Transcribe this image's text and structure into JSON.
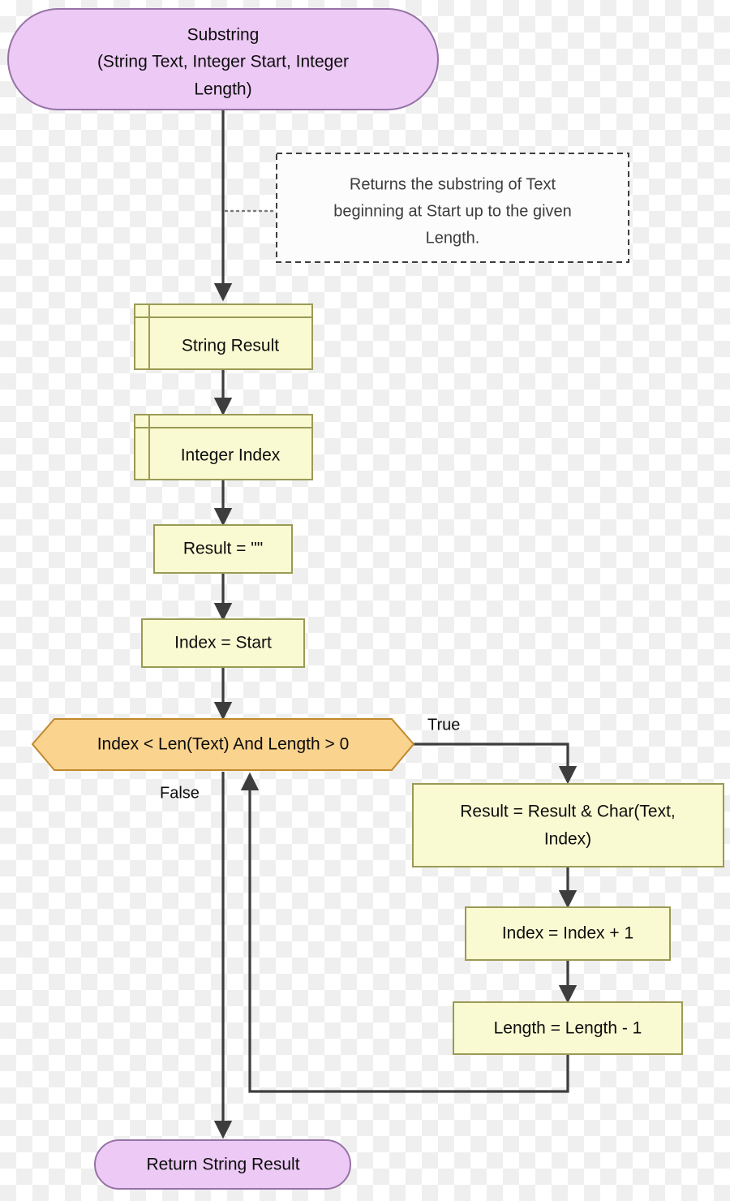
{
  "diagram": {
    "title": "Substring function flowchart",
    "colors": {
      "terminal_fill": "#edc9f5",
      "terminal_stroke": "#9673a6",
      "process_fill": "#fafad2",
      "process_stroke": "#9a9a55",
      "decision_fill": "#fad38e",
      "decision_stroke": "#c08a2e",
      "edge": "#3d3d3d",
      "comment_fill": "#fcfcfc",
      "comment_stroke": "#3d3d3d"
    },
    "nodes": {
      "start": {
        "shape": "terminal",
        "line1": "Substring",
        "line2": "(String Text, Integer Start, Integer",
        "line3": "Length)"
      },
      "comment": {
        "shape": "comment",
        "line1": "Returns the substring of Text",
        "line2": "beginning at Start up to the given",
        "line3": "Length."
      },
      "decl_result": {
        "shape": "declaration",
        "label": "String Result"
      },
      "decl_index": {
        "shape": "declaration",
        "label": "Integer Index"
      },
      "init_result": {
        "shape": "process",
        "label": "Result = \"\""
      },
      "init_index": {
        "shape": "process",
        "label": "Index = Start"
      },
      "condition": {
        "shape": "decision",
        "label": "Index < Len(Text) And Length > 0"
      },
      "append_char": {
        "shape": "process",
        "line1": "Result = Result & Char(Text,",
        "line2": "Index)"
      },
      "inc_index": {
        "shape": "process",
        "label": "Index = Index + 1"
      },
      "dec_length": {
        "shape": "process",
        "label": "Length = Length - 1"
      },
      "return": {
        "shape": "terminal",
        "label": "Return String Result"
      }
    },
    "edge_labels": {
      "true": "True",
      "false": "False"
    }
  }
}
